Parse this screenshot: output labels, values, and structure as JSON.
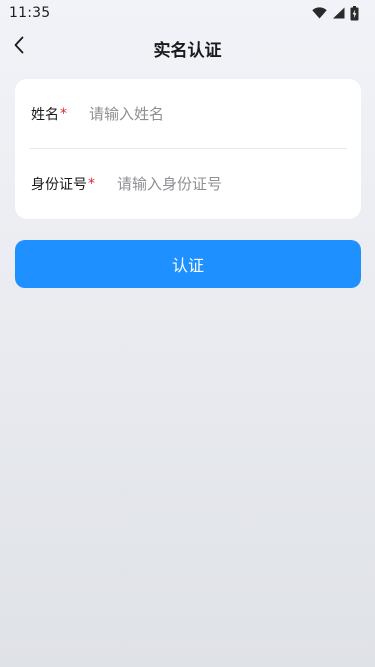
{
  "status_bar": {
    "time": "11:35",
    "icons": [
      "wifi-icon",
      "signal-icon",
      "battery-charging-icon"
    ]
  },
  "nav": {
    "back_icon": "chevron-left-icon",
    "title": "实名认证"
  },
  "form": {
    "name": {
      "label": "姓名",
      "required_mark": "*",
      "value": "",
      "placeholder": "请输入姓名"
    },
    "id_number": {
      "label": "身份证号",
      "required_mark": "*",
      "value": "",
      "placeholder": "请输入身份证号"
    }
  },
  "submit": {
    "label": "认证"
  },
  "colors": {
    "accent": "#1e90ff",
    "required": "#e0262b",
    "card": "#ffffff"
  }
}
